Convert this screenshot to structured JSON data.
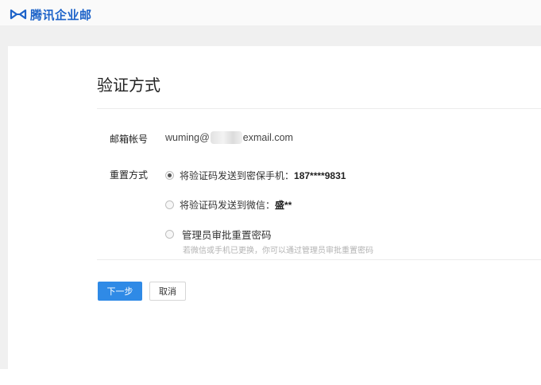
{
  "brand": {
    "name": "腾讯企业邮",
    "color": "#1d63c9",
    "icon": "tencent-exmail-logo-icon"
  },
  "page": {
    "title": "验证方式"
  },
  "account": {
    "label": "邮箱帐号",
    "value_prefix": "wuming@",
    "value_suffix": "exmail.com"
  },
  "reset": {
    "label": "重置方式",
    "options": [
      {
        "prefix": "将验证码发送到密保手机：",
        "detail": "187****9831",
        "checked": true
      },
      {
        "prefix": "将验证码发送到微信：",
        "detail": "盛**",
        "checked": false
      },
      {
        "prefix": "",
        "detail": "管理员审批重置密码",
        "checked": false
      }
    ],
    "hint": "若微信或手机已更换，你可以通过管理员审批重置密码"
  },
  "actions": {
    "next_label": "下一步",
    "cancel_label": "取消",
    "accent": "#2f8ae6"
  }
}
